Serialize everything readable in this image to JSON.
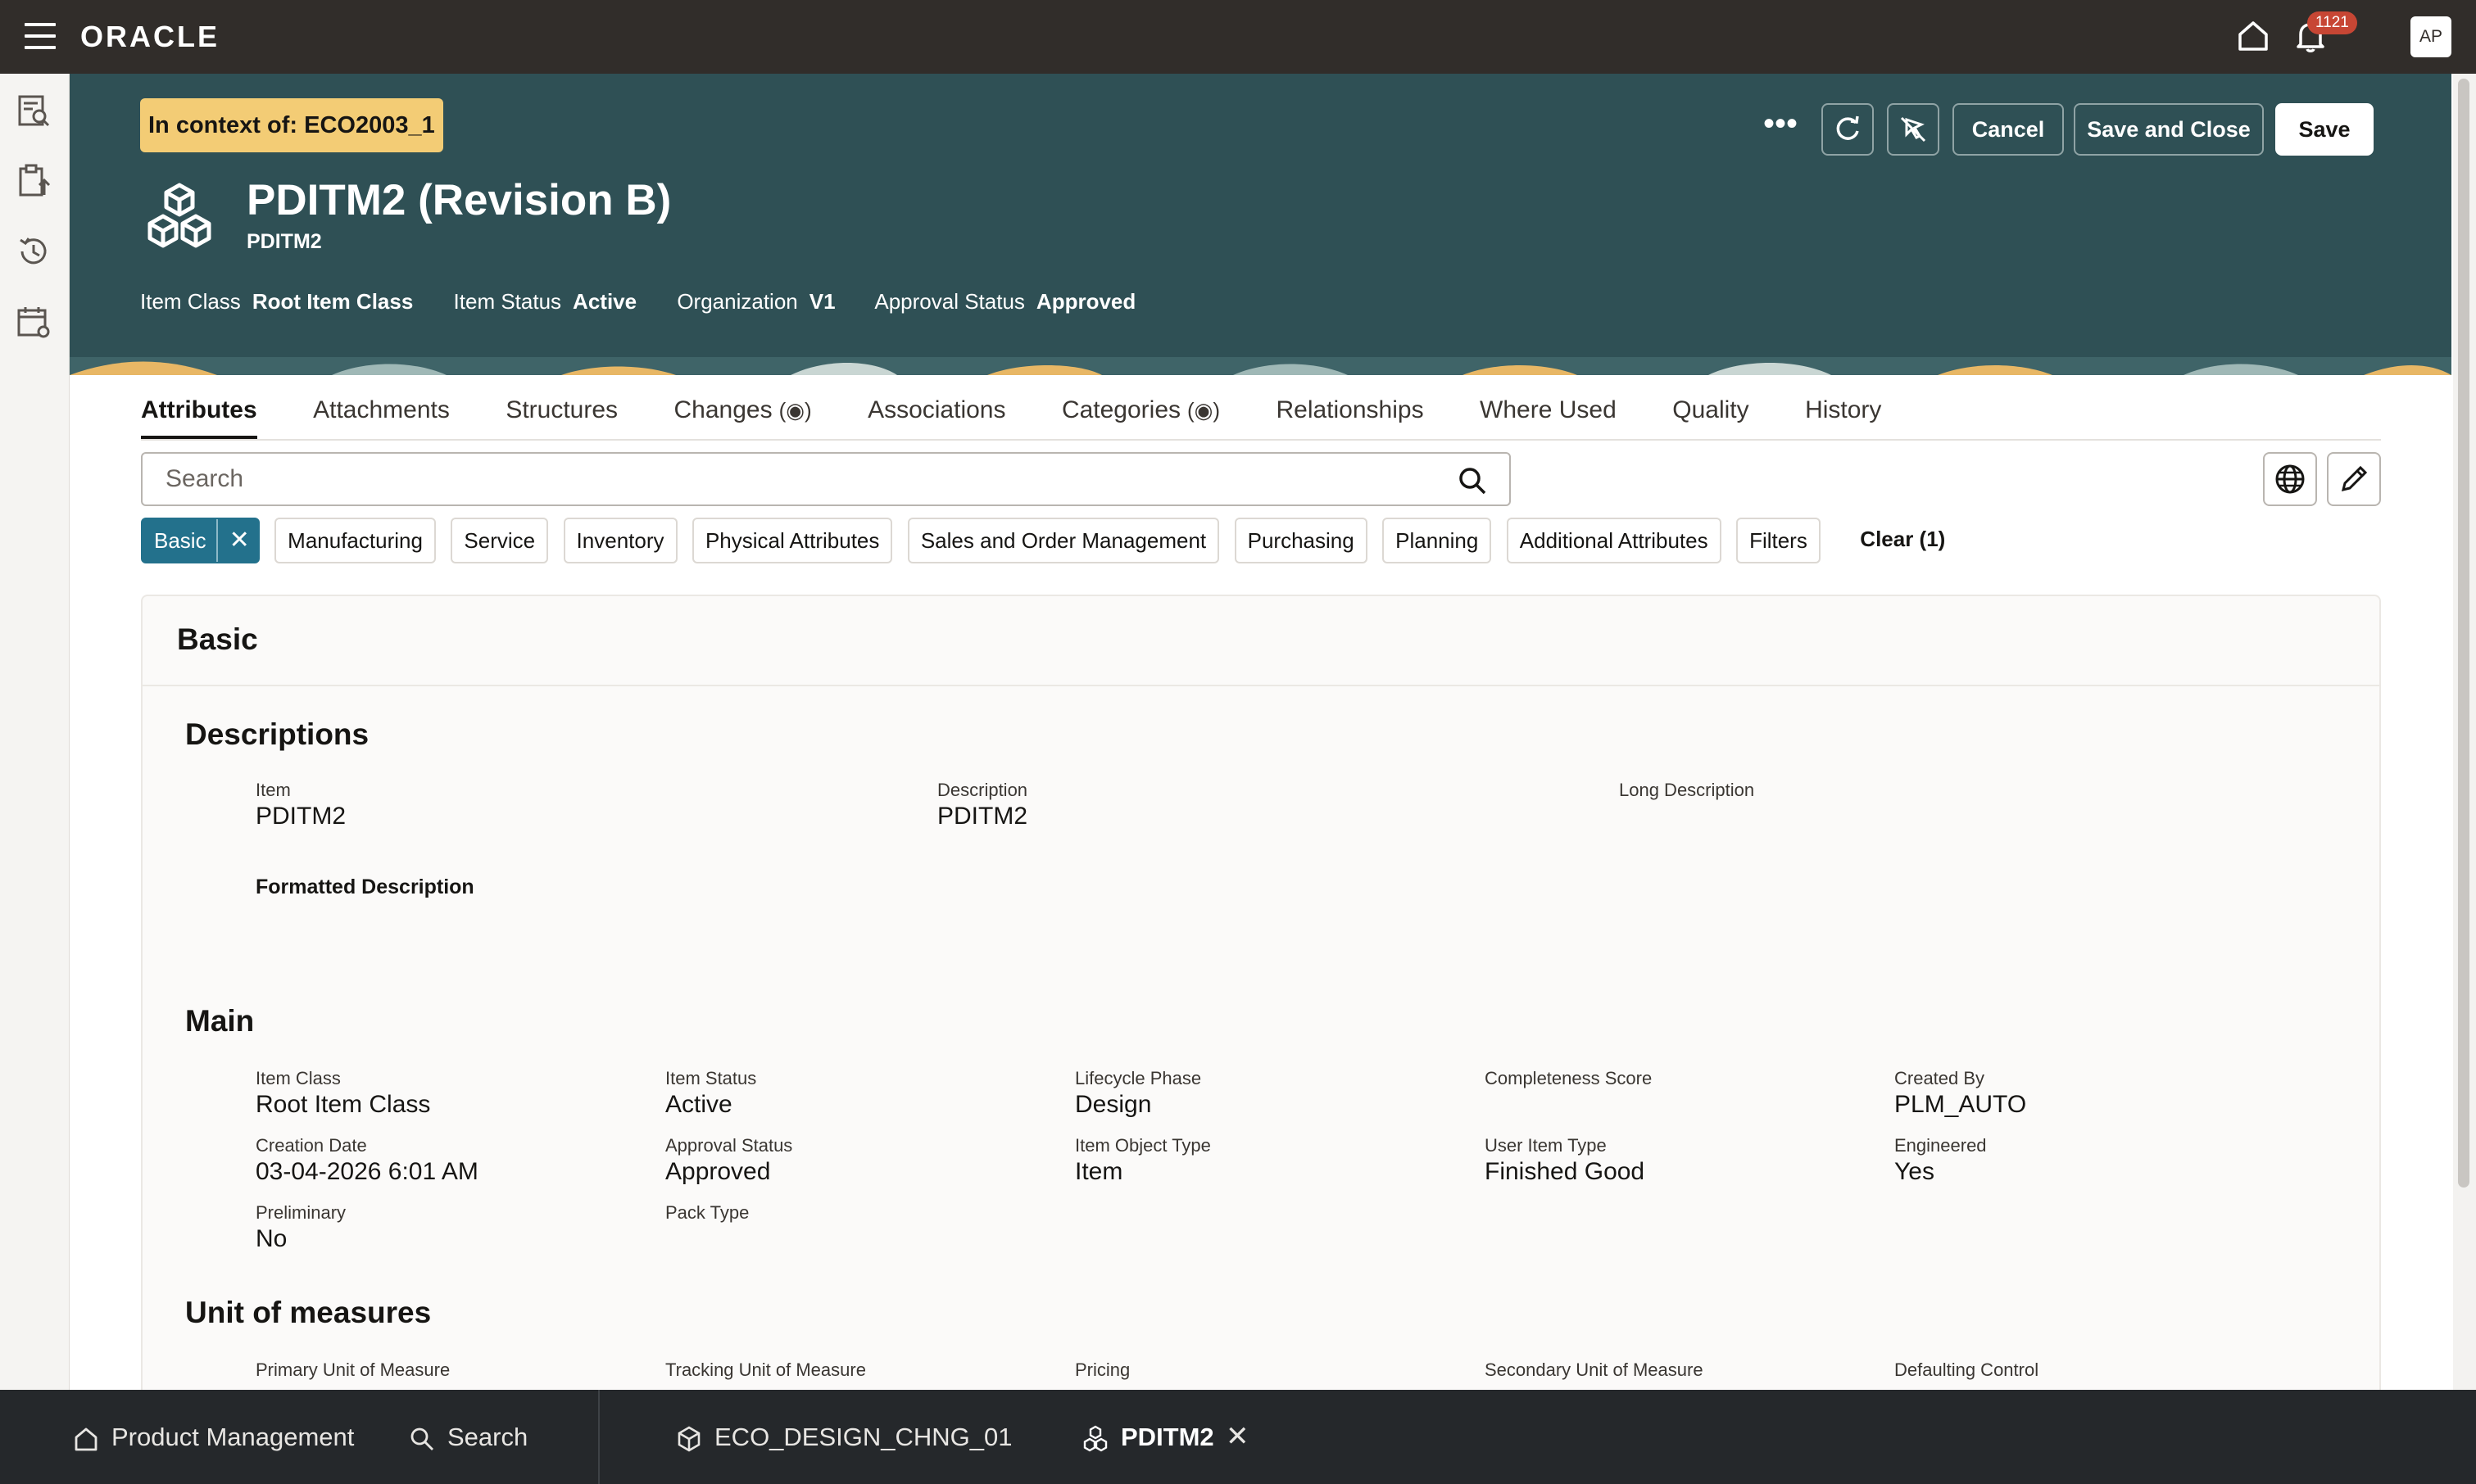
{
  "topbar": {
    "logo": "ORACLE",
    "notifications_count": "1121",
    "avatar_initials": "AP"
  },
  "header": {
    "context": "In context of: ECO2003_1",
    "title": "PDITM2 (Revision B)",
    "subtitle": "PDITM2",
    "meta": [
      {
        "label": "Item Class",
        "value": "Root Item Class"
      },
      {
        "label": "Item Status",
        "value": "Active"
      },
      {
        "label": "Organization",
        "value": "V1"
      },
      {
        "label": "Approval Status",
        "value": "Approved"
      }
    ],
    "actions": {
      "more": "•••",
      "cancel": "Cancel",
      "save_close": "Save and Close",
      "save": "Save"
    }
  },
  "tabs": [
    {
      "label": "Attributes"
    },
    {
      "label": "Attachments"
    },
    {
      "label": "Structures"
    },
    {
      "label": "Changes",
      "indicator": "(◉)"
    },
    {
      "label": "Associations"
    },
    {
      "label": "Categories",
      "indicator": "(◉)"
    },
    {
      "label": "Relationships"
    },
    {
      "label": "Where Used"
    },
    {
      "label": "Quality"
    },
    {
      "label": "History"
    }
  ],
  "search": {
    "placeholder": "Search"
  },
  "chips": {
    "selected": "Basic",
    "items": [
      "Manufacturing",
      "Service",
      "Inventory",
      "Physical Attributes",
      "Sales and Order Management",
      "Purchasing",
      "Planning",
      "Additional Attributes",
      "Filters"
    ],
    "clear": "Clear (1)"
  },
  "card": {
    "title": "Basic",
    "descriptions": {
      "title": "Descriptions",
      "item_label": "Item",
      "item_value": "PDITM2",
      "desc_label": "Description",
      "desc_value": "PDITM2",
      "long_desc_label": "Long Description",
      "formatted_desc_label": "Formatted Description"
    },
    "main": {
      "title": "Main",
      "fields": [
        {
          "label": "Item Class",
          "value": "Root Item Class"
        },
        {
          "label": "Item Status",
          "value": "Active"
        },
        {
          "label": "Lifecycle Phase",
          "value": "Design"
        },
        {
          "label": "Completeness Score",
          "value": ""
        },
        {
          "label": "Created By",
          "value": "PLM_AUTO"
        },
        {
          "label": "Creation Date",
          "value": "03-04-2026 6:01 AM"
        },
        {
          "label": "Approval Status",
          "value": "Approved"
        },
        {
          "label": "Item Object Type",
          "value": "Item"
        },
        {
          "label": "User Item Type",
          "value": "Finished Good"
        },
        {
          "label": "Engineered",
          "value": "Yes"
        },
        {
          "label": "Preliminary",
          "value": "No"
        },
        {
          "label": "Pack Type",
          "value": ""
        }
      ]
    },
    "uom": {
      "title": "Unit of measures",
      "fields": [
        {
          "label": "Primary Unit of Measure"
        },
        {
          "label": "Tracking Unit of Measure"
        },
        {
          "label": "Pricing"
        },
        {
          "label": "Secondary Unit of Measure"
        },
        {
          "label": "Defaulting Control"
        }
      ]
    }
  },
  "dock": {
    "home": "Product Management",
    "search": "Search",
    "tab1": "ECO_DESIGN_CHNG_01",
    "tab2": "PDITM2"
  },
  "colors": {
    "topbar": "#312d2a",
    "header": "#2f5055",
    "context_pill": "#f3cc75",
    "selected_chip": "#23718c",
    "badge": "#c74634",
    "dock": "#25282b"
  }
}
